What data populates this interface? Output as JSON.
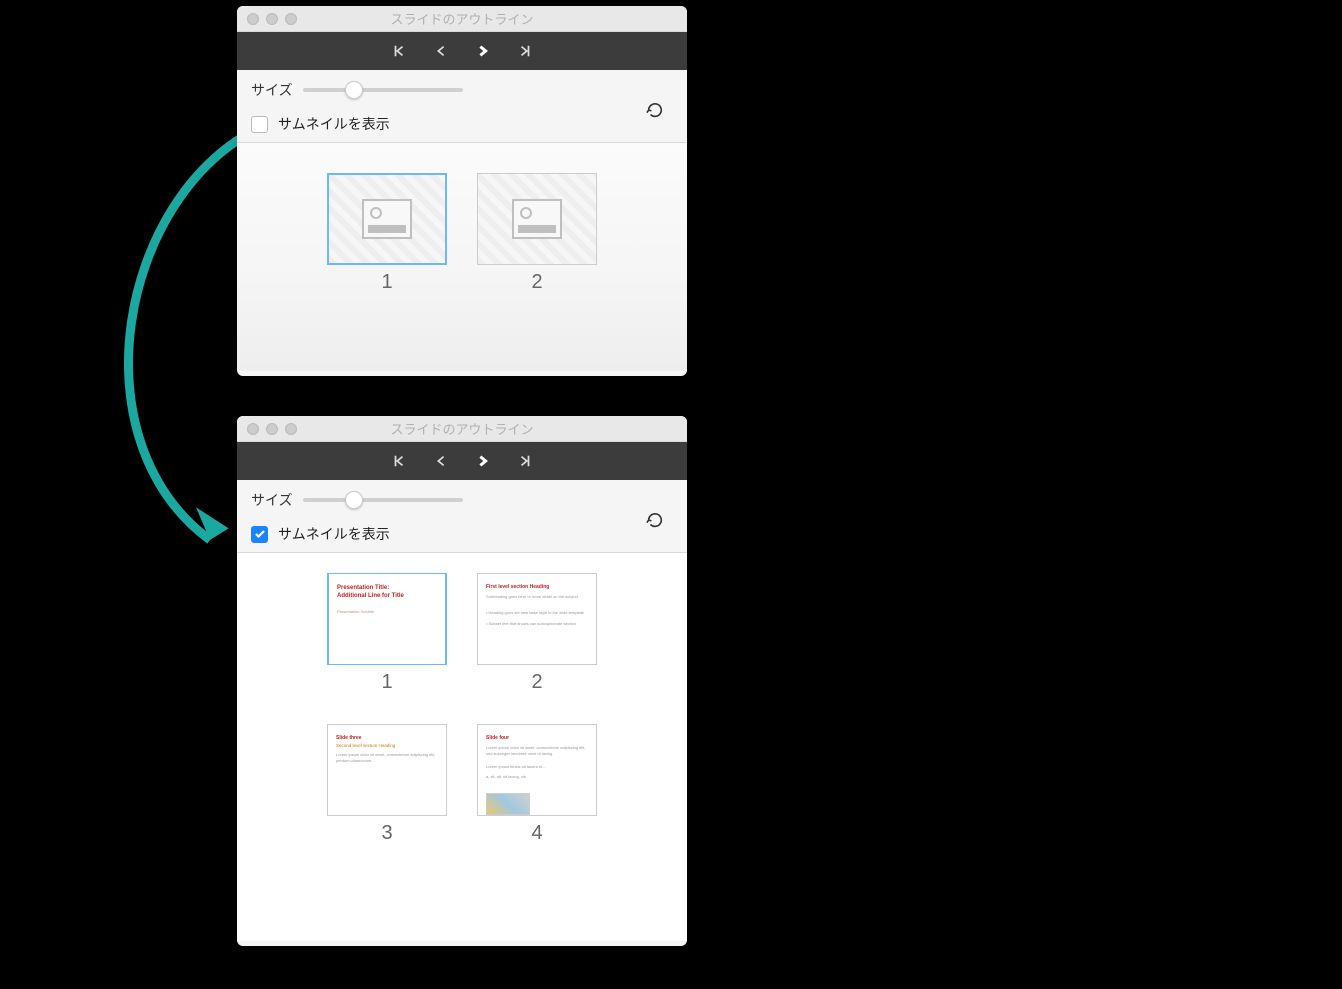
{
  "window_title": "スライドのアウトライン",
  "controls": {
    "size_label": "サイズ",
    "checkbox_label": "サムネイルを表示"
  },
  "panel1": {
    "checkbox_checked": false,
    "thumbs": [
      {
        "num": "1",
        "type": "placeholder",
        "selected": true
      },
      {
        "num": "2",
        "type": "placeholder",
        "selected": false
      }
    ]
  },
  "panel2": {
    "checkbox_checked": true,
    "thumbs": [
      {
        "num": "1",
        "type": "content",
        "selected": true
      },
      {
        "num": "2",
        "type": "content",
        "selected": false
      },
      {
        "num": "3",
        "type": "content",
        "selected": false
      },
      {
        "num": "4",
        "type": "content",
        "selected": false
      }
    ]
  },
  "slide_content": {
    "s1": {
      "line1": "Presentation Title:",
      "line2": "Additional Line for Title",
      "sub": "Presentation Subtitle"
    },
    "s2": {
      "heading": "First level section Heading",
      "body1": "Subheading goes here or more detail on the subject",
      "bullet1": "• Heading goes set new base style in the slide template",
      "bullet2": "• Subset text that shows can subcaptionate section"
    },
    "s3": {
      "heading": "Slide three",
      "sub": "Second level section Heading",
      "body": "Lorem ipsum dolor sit amet, consectetum adipiscing elit, perdum ullamcorum."
    },
    "s4": {
      "heading": "Slide four",
      "body": "Lorem ipsum dolor sit amet, consectetum adipiscing elit, sed susveget hendrerit omni ut lacing.",
      "body2": "Lorem ipsum titulus sit lacera et...",
      "body3": "a, sit, alt, sit lacing, vib"
    }
  }
}
